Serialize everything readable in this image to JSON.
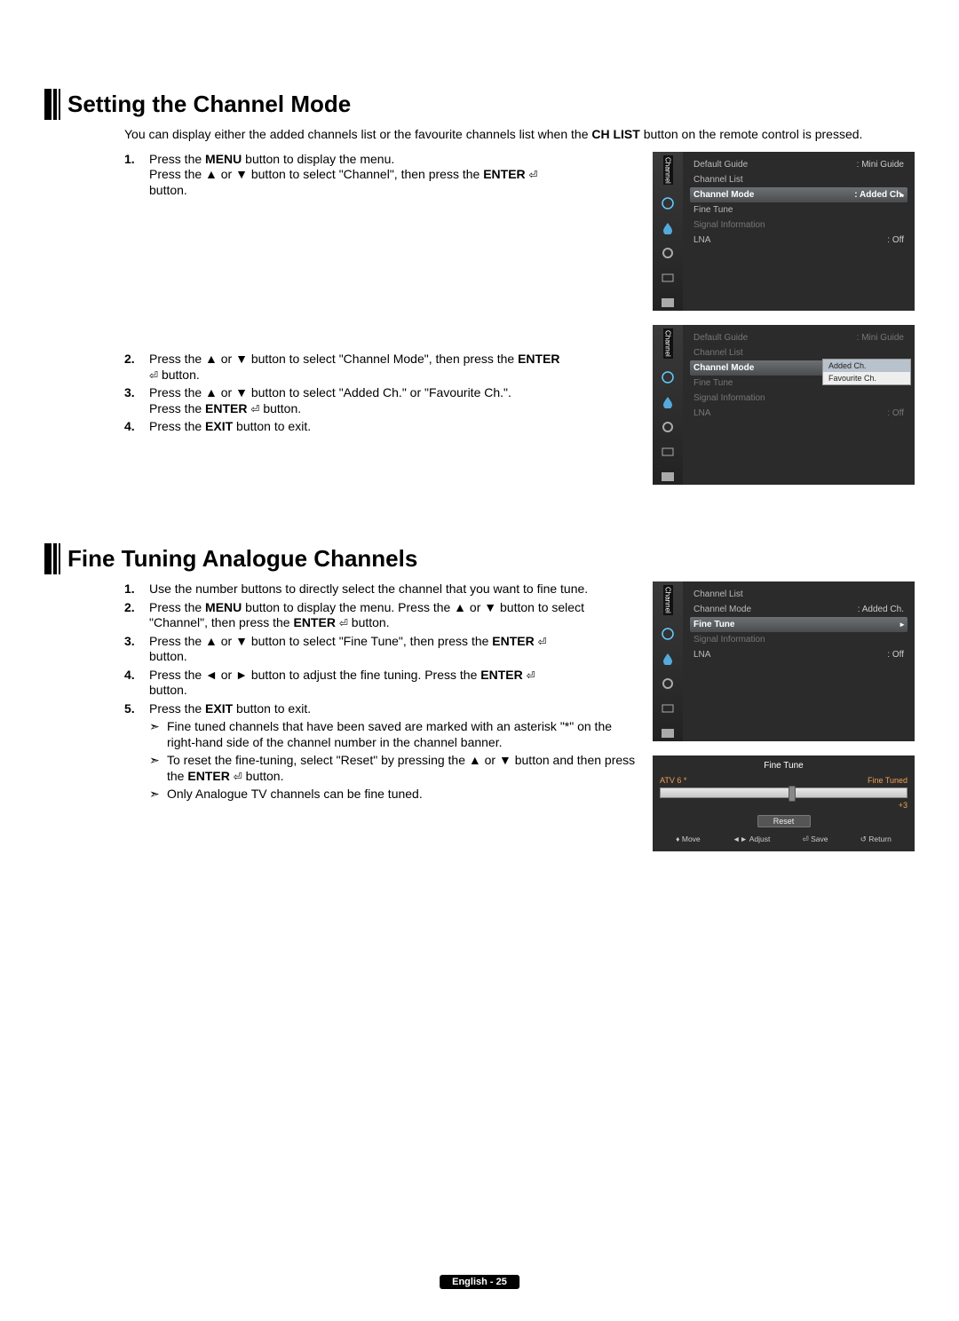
{
  "section1": {
    "title": "Setting the Channel Mode",
    "intro_pre": "You can display either the added channels list or the favourite channels list when the ",
    "intro_bold": "CH LIST",
    "intro_post": " button on the remote control is pressed.",
    "steps": {
      "s1a": "Press the ",
      "s1b": "MENU",
      "s1c": " button to display the menu.",
      "s1d": "Press the ▲ or ▼ button to select \"Channel\", then press the ",
      "s1e": "ENTER",
      "s1f": " button.",
      "s2a": "Press the ▲ or ▼ button to select \"Channel Mode\", then press the ",
      "s2b": "ENTER",
      "s2c": " button.",
      "s3a": "Press the ▲ or ▼ button to select \"Added Ch.\" or \"Favourite Ch.\".",
      "s3b": "Press the ",
      "s3c": "ENTER",
      "s3d": " button.",
      "s4a": "Press the ",
      "s4b": "EXIT",
      "s4c": " button to exit."
    }
  },
  "section2": {
    "title": "Fine Tuning Analogue Channels",
    "steps": {
      "s1": "Use the number buttons to directly select the channel that you want to fine tune.",
      "s2a": "Press the ",
      "s2b": "MENU",
      "s2c": " button to display the menu. Press the ▲ or ▼ button to select \"Channel\", then press the ",
      "s2d": "ENTER",
      "s2e": " button.",
      "s3a": "Press the ▲ or ▼ button to select \"Fine Tune\", then press the ",
      "s3b": "ENTER",
      "s3c": " button.",
      "s4a": "Press the ◄ or ► button to adjust the fine tuning. Press the ",
      "s4b": "ENTER",
      "s4c": " button.",
      "s5a": "Press the ",
      "s5b": "EXIT",
      "s5c": " button to exit."
    },
    "notes": {
      "n1": "Fine tuned channels that have been saved are marked with an asterisk \"*\" on the right-hand side of the channel number in the channel banner.",
      "n2a": "To reset the fine-tuning, select \"Reset\" by pressing the ▲ or ▼ button and then press the ",
      "n2b": "ENTER",
      "n2c": " button.",
      "n3": "Only Analogue TV channels can be fine tuned."
    }
  },
  "osd": {
    "sidebar_label": "Channel",
    "m1": {
      "r1l": "Default Guide",
      "r1r": ": Mini Guide",
      "r2l": "Channel List",
      "r2r": "",
      "r3l": "Channel Mode",
      "r3r": ": Added Ch.",
      "r4l": "Fine Tune",
      "r4r": "",
      "r5l": "Signal Information",
      "r5r": "",
      "r6l": "LNA",
      "r6r": ": Off"
    },
    "m2": {
      "r1l": "Default Guide",
      "r1r": ": Mini Guide",
      "r2l": "Channel List",
      "r2r": "",
      "r3l": "Channel Mode",
      "r3r": ":",
      "r4l": "Fine Tune",
      "r4r": "",
      "r5l": "Signal Information",
      "r5r": "",
      "r6l": "LNA",
      "r6r": ": Off",
      "p1": "Added Ch.",
      "p2": "Favourite Ch."
    },
    "m3": {
      "r1l": "Channel List",
      "r1r": "",
      "r2l": "Channel Mode",
      "r2r": ": Added Ch.",
      "r3l": "Fine Tune",
      "r3r": "",
      "r4l": "Signal Information",
      "r4r": "",
      "r5l": "LNA",
      "r5r": ": Off"
    }
  },
  "finetune": {
    "title": "Fine Tune",
    "channel": "ATV 6 *",
    "status": "Fine Tuned",
    "value": "+3",
    "reset": "Reset",
    "f1": "Move",
    "f2": "Adjust",
    "f3": "Save",
    "f4": "Return",
    "sym1": "♦",
    "sym2": "◄►",
    "sym3": "⏎",
    "sym4": "↺"
  },
  "footer": "English - 25",
  "nums": {
    "n1": "1.",
    "n2": "2.",
    "n3": "3.",
    "n4": "4.",
    "n5": "5."
  },
  "arrow": "➣"
}
